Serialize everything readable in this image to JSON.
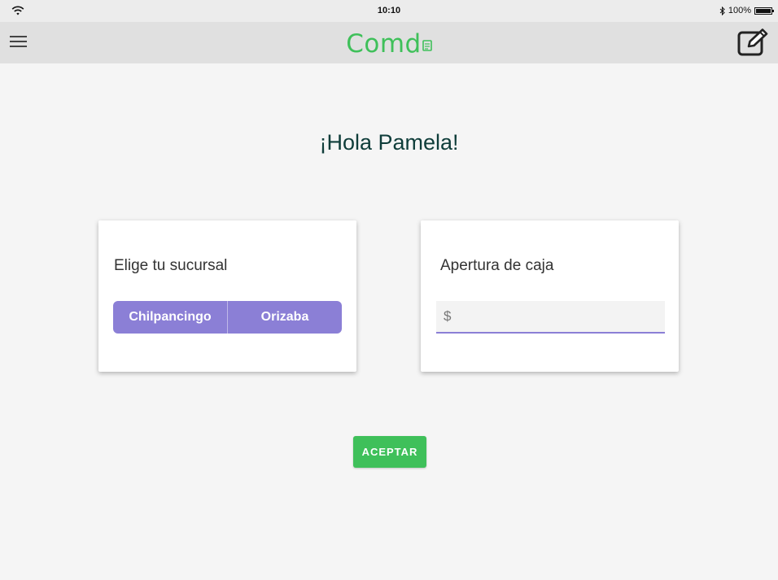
{
  "status_bar": {
    "time": "10:10",
    "battery_text": "100%",
    "icons": [
      "wifi-icon",
      "bluetooth-icon",
      "battery-icon"
    ]
  },
  "app_bar": {
    "logo_text": "Comd",
    "logo_color": "#3fc05a",
    "icons": [
      "menu-icon",
      "edit-icon"
    ]
  },
  "greeting": "¡Hola Pamela!",
  "branch_card": {
    "title": "Elige tu sucursal",
    "options": [
      "Chilpancingo",
      "Orizaba"
    ],
    "accent_color": "#8b7fd6"
  },
  "cash_card": {
    "title": "Apertura de caja",
    "currency_symbol": "$",
    "value": "",
    "placeholder": ""
  },
  "actions": {
    "accept_label": "ACEPTAR",
    "accept_color": "#3fc05a"
  }
}
